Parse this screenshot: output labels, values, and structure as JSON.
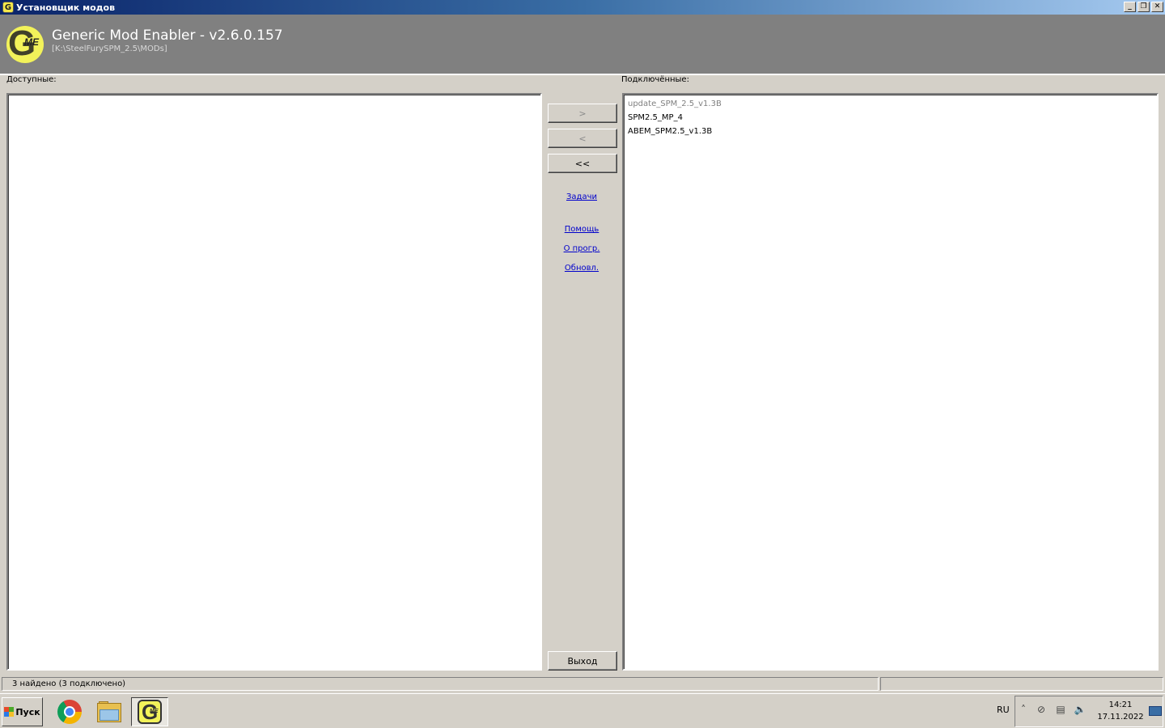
{
  "window": {
    "title": "Установщик модов",
    "icon_letter": "G",
    "minimize_glyph": "_",
    "restore_glyph": "❐",
    "close_glyph": "✕"
  },
  "header": {
    "app_name": "Generic Mod Enabler - v2.6.0.157",
    "path": "[K:\\SteelFurySPM_2.5\\MODs]",
    "logo_letter": "G",
    "logo_sub": "ME"
  },
  "left_panel": {
    "label": "Доступные:",
    "items": []
  },
  "right_panel": {
    "label": "Подключённые:",
    "items": [
      {
        "text": "update_SPM_2.5_v1.3B",
        "disabled": true
      },
      {
        "text": "SPM2.5_MP_4",
        "disabled": false
      },
      {
        "text": "ABEM_SPM2.5_v1.3B",
        "disabled": false
      }
    ]
  },
  "middle": {
    "add_label": ">",
    "remove_label": "<",
    "remove_all_label": "<<",
    "tasks_link": "Задачи",
    "help_link": "Помощь",
    "about_link": "О прогр.",
    "update_link": "Обновл.",
    "exit_label": "Выход"
  },
  "status": {
    "text": "3 найдено  (3 подключено)",
    "right_text": ""
  },
  "taskbar": {
    "start_label": "Пуск",
    "language": "RU",
    "time": "14:21",
    "date": "17.11.2022",
    "tray_icons": [
      "chevron-up-icon",
      "link-icon",
      "network-icon",
      "speaker-icon"
    ],
    "tray_glyphs": [
      "˄",
      "⊘",
      "▤",
      "🔈"
    ]
  }
}
